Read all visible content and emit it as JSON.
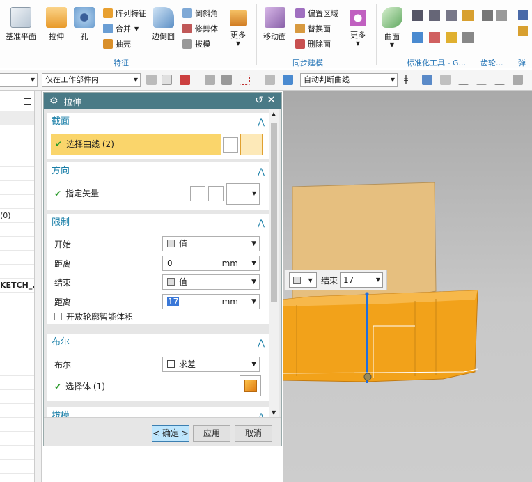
{
  "ribbon": {
    "buttons": {
      "datum_plane": "基准平面",
      "extrude": "拉伸",
      "hole": "孔",
      "pattern_feature": "阵列特征",
      "combine": "合并",
      "shell": "抽壳",
      "edge_blend": "边倒圆",
      "chamfer": "倒斜角",
      "trim_body": "修剪体",
      "draft": "拔模",
      "more_1": "更多",
      "move_face": "移动面",
      "offset_region": "偏置区域",
      "replace_face": "替换面",
      "delete_face": "删除面",
      "more_2": "更多",
      "surface": "曲面"
    },
    "groups": {
      "feature": "特征",
      "sync_modeling": "同步建模",
      "standard_tools": "标准化工具 - G...",
      "gear": "齿轮...",
      "spring": "弹簧"
    }
  },
  "toolbar": {
    "selection_scope": "仅在工作部件内",
    "curve_rule": "自动判断曲线"
  },
  "left_panel": {
    "rows": [
      "(0)",
      "KETCH_..."
    ]
  },
  "dialog": {
    "title": "拉伸",
    "section_group": {
      "header": "截面",
      "select_curve": "选择曲线 (2)"
    },
    "direction_group": {
      "header": "方向",
      "specify_vector": "指定矢量"
    },
    "limits_group": {
      "header": "限制",
      "start_label": "开始",
      "start_value": "值",
      "distance_label_1": "距离",
      "distance_value_1": "0",
      "end_label": "结束",
      "end_value": "值",
      "distance_label_2": "距离",
      "distance_value_2": "17",
      "unit": "mm",
      "open_profile": "开放轮廓智能体积"
    },
    "boolean_group": {
      "header": "布尔",
      "boolean_label": "布尔",
      "boolean_value": "求差",
      "select_body": "选择体 (1)"
    },
    "draft_group": {
      "header": "拔模"
    },
    "buttons": {
      "ok": "< 确定 >",
      "apply": "应用",
      "cancel": "取消"
    }
  },
  "viewport": {
    "end_label": "结束",
    "end_value": "17"
  },
  "colors": {
    "dialog_title_bg": "#4a7a86",
    "selection_highlight": "#fad56b",
    "section_header": "#1a7fa8",
    "body_orange": "#f2a21a",
    "sketch_tan": "#e8c181"
  }
}
